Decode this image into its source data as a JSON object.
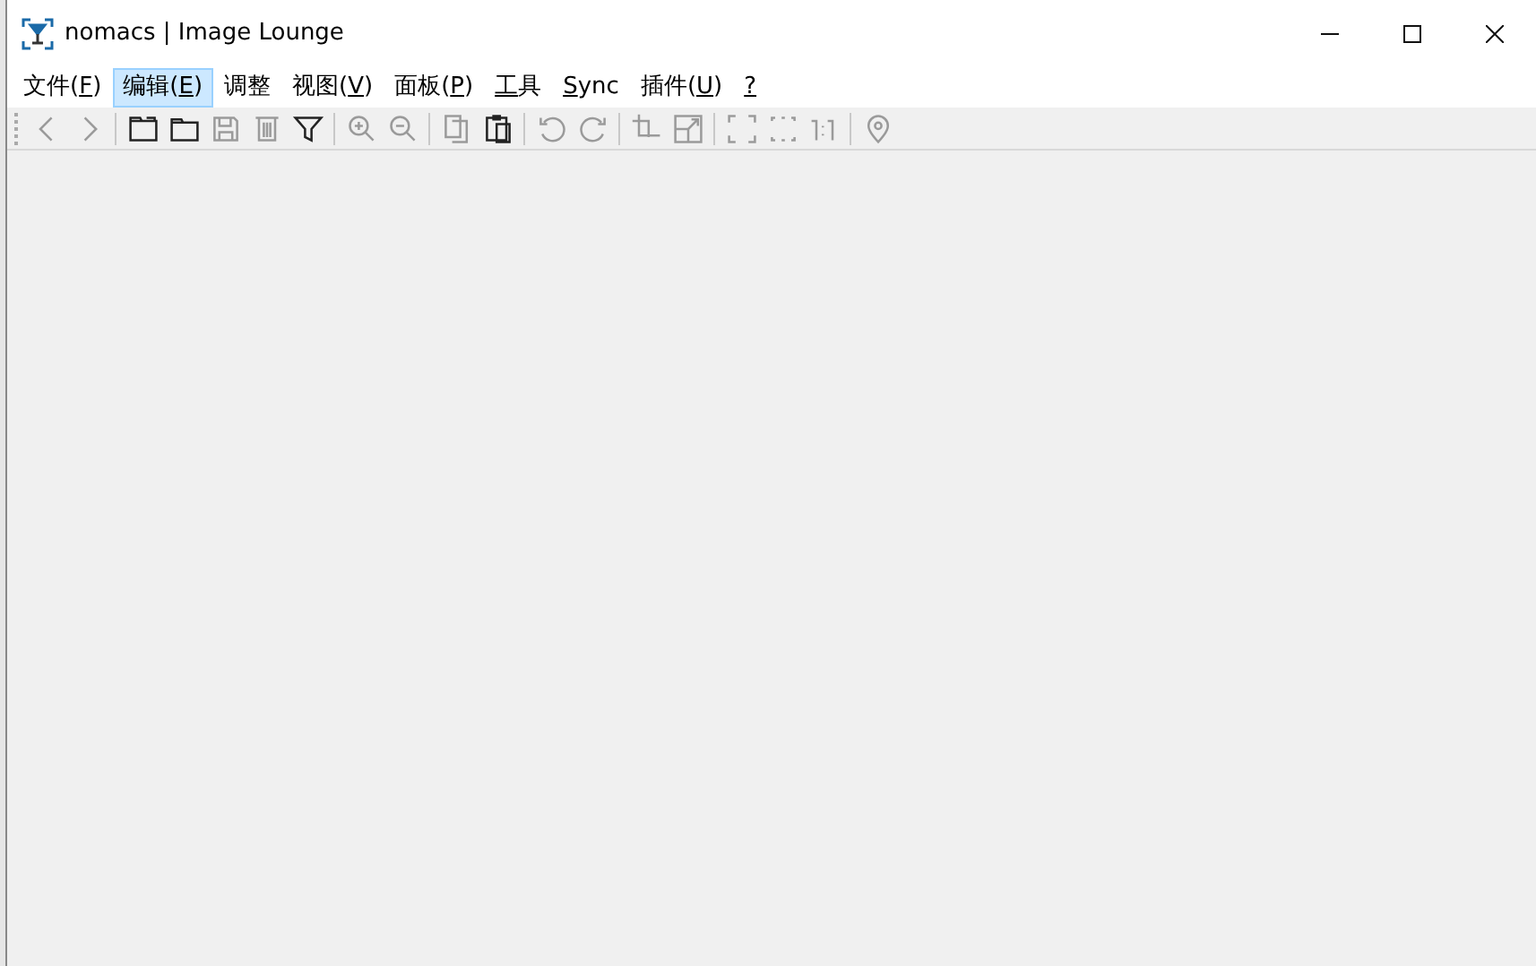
{
  "window": {
    "title": "nomacs | Image Lounge"
  },
  "menu": [
    {
      "text_before": "文件(",
      "key": "F",
      "text_after": ")",
      "selected": false
    },
    {
      "text_before": "编辑(",
      "key": "E",
      "text_after": ")",
      "selected": true
    },
    {
      "text_before": "调整",
      "selected": false
    },
    {
      "text_before": "视图(",
      "key": "V",
      "text_after": ")",
      "selected": false
    },
    {
      "text_before": "面板(",
      "key": "P",
      "text_after": ")",
      "selected": false
    },
    {
      "key": "工",
      "text_after": "具",
      "selected": false
    },
    {
      "key": "S",
      "text_after": "ync",
      "selected": false
    },
    {
      "text_before": "插件(",
      "key": "U",
      "text_after": ")",
      "selected": false
    },
    {
      "key": "?",
      "selected": false
    }
  ],
  "toolbar": [
    [
      {
        "kind": "back",
        "disabled": true
      },
      {
        "kind": "forward",
        "disabled": true
      }
    ],
    [
      {
        "kind": "new-folder",
        "disabled": false
      },
      {
        "kind": "folder",
        "disabled": false
      },
      {
        "kind": "save",
        "disabled": true
      },
      {
        "kind": "delete",
        "disabled": true
      },
      {
        "kind": "filter",
        "disabled": false
      }
    ],
    [
      {
        "kind": "zoom-in",
        "disabled": true
      },
      {
        "kind": "zoom-out",
        "disabled": true
      }
    ],
    [
      {
        "kind": "copy",
        "disabled": true
      },
      {
        "kind": "paste",
        "disabled": false
      }
    ],
    [
      {
        "kind": "rotate-left",
        "disabled": true
      },
      {
        "kind": "rotate-right",
        "disabled": true
      }
    ],
    [
      {
        "kind": "crop",
        "disabled": true
      },
      {
        "kind": "resize",
        "disabled": true
      }
    ],
    [
      {
        "kind": "fullscreen",
        "disabled": true
      },
      {
        "kind": "frameless",
        "disabled": true
      },
      {
        "kind": "actual-size",
        "disabled": true
      }
    ],
    [
      {
        "kind": "pin",
        "disabled": true
      }
    ]
  ]
}
